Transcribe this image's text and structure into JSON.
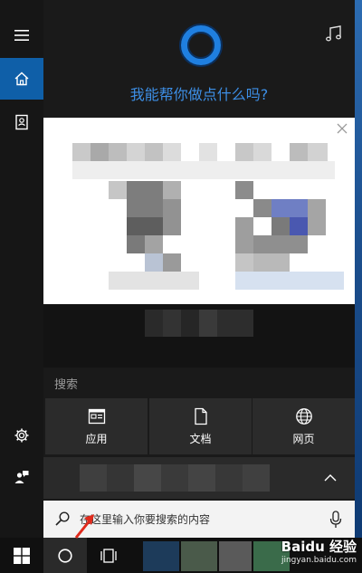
{
  "header": {
    "greeting": "我能帮你做点什么吗?"
  },
  "search": {
    "section_label": "搜索",
    "placeholder": "在这里输入你要搜索的内容"
  },
  "categories": [
    {
      "label": "应用",
      "icon": "apps-icon"
    },
    {
      "label": "文档",
      "icon": "document-icon"
    },
    {
      "label": "网页",
      "icon": "globe-icon"
    }
  ],
  "rail": {
    "items": [
      "hamburger-menu-icon",
      "home-icon",
      "notebook-icon",
      "settings-gear-icon",
      "feedback-icon"
    ]
  },
  "watermark": {
    "main": "Baidu 经验",
    "sub": "jingyan.baidu.com"
  },
  "colors": {
    "accent": "#0f5fa8",
    "cortana_blue": "#1f7fe0",
    "greeting_text": "#3d8fe6"
  }
}
